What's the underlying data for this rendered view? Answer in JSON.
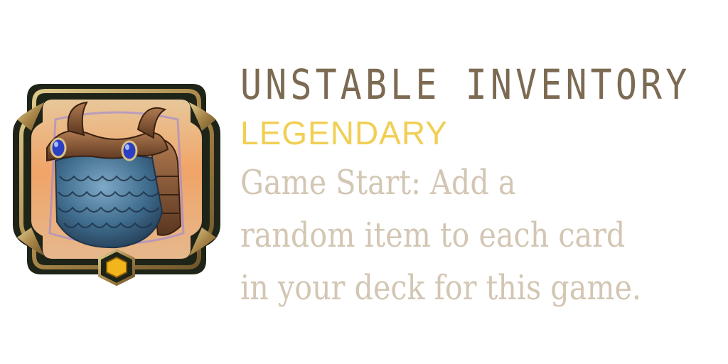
{
  "card": {
    "title": "UNSTABLE INVENTORY",
    "rarity": "LEGENDARY",
    "description_lines": [
      "Game Start: Add a",
      "random item to each card",
      "in your deck for this game."
    ],
    "icon": "armor-scale-vest-icon",
    "colors": {
      "title": "#7c6a52",
      "rarity": "#f1cf55",
      "description": "#d3c6b3",
      "frame_gold": "#b8985a",
      "frame_dark": "#1f2418",
      "gem": "#f2b51b"
    }
  }
}
